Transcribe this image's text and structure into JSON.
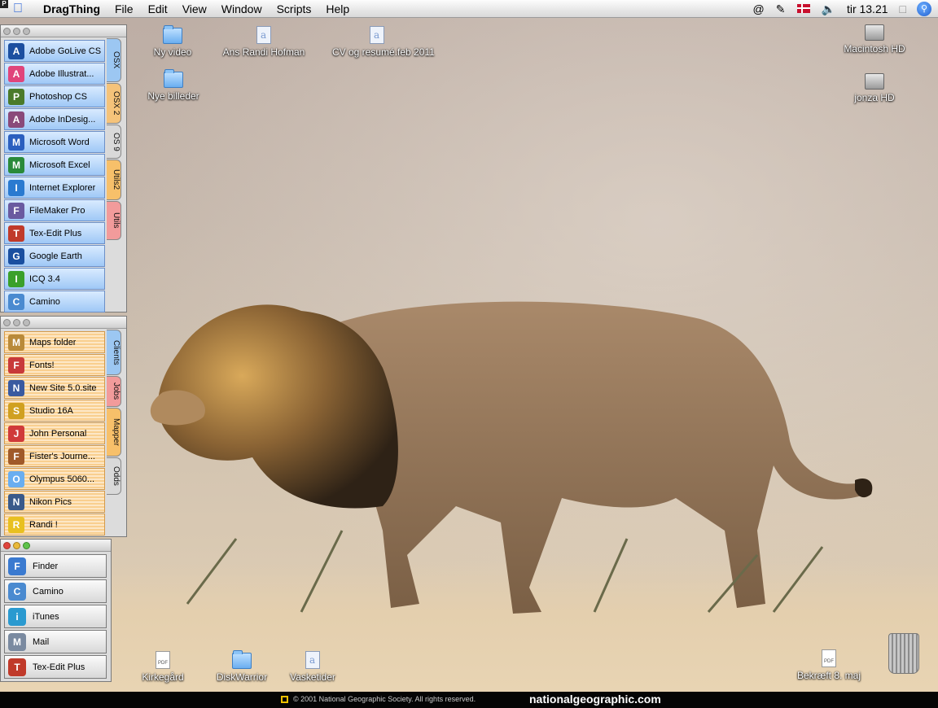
{
  "menubar": {
    "app_name": "DragThing",
    "menus": [
      "File",
      "Edit",
      "View",
      "Window",
      "Scripts",
      "Help"
    ],
    "status": {
      "at_sign": "@",
      "clock": "tir 13.21"
    }
  },
  "desktop": {
    "icons_top": [
      {
        "label": "Ny video",
        "type": "folder"
      },
      {
        "label": "Nye billeder",
        "type": "folder"
      },
      {
        "label": "Ans Randi Hofman",
        "type": "document"
      },
      {
        "label": "CV og resumé.feb 2011",
        "type": "document"
      }
    ],
    "drives": [
      {
        "label": "Macintosh HD"
      },
      {
        "label": "jonza HD"
      }
    ],
    "icons_bottom": [
      {
        "label": "Kirkegård",
        "type": "pdf"
      },
      {
        "label": "DiskWarrior",
        "type": "folder"
      },
      {
        "label": "Vasketider",
        "type": "document"
      },
      {
        "label": "Bekræft 8. maj",
        "type": "pdf"
      }
    ],
    "trash_icon": "trash-icon"
  },
  "dock1": {
    "items": [
      {
        "label": "Adobe GoLive CS",
        "color": "#1c4fa0"
      },
      {
        "label": "Adobe Illustrat...",
        "color": "#e0457b"
      },
      {
        "label": "Photoshop CS",
        "color": "#4a7a2a"
      },
      {
        "label": "Adobe InDesig...",
        "color": "#8a4a7a"
      },
      {
        "label": "Microsoft Word",
        "color": "#2b5fbf"
      },
      {
        "label": "Microsoft Excel",
        "color": "#2a8a3a"
      },
      {
        "label": "Internet Explorer",
        "color": "#2a7ad0"
      },
      {
        "label": "FileMaker Pro",
        "color": "#6a5aa0"
      },
      {
        "label": "Tex-Edit Plus",
        "color": "#c03a2a"
      },
      {
        "label": "Google Earth",
        "color": "#1a4fa0"
      },
      {
        "label": "ICQ 3.4",
        "color": "#3aa02a"
      },
      {
        "label": "Camino",
        "color": "#4a8ad0"
      }
    ],
    "tabs": [
      {
        "label": "OSX",
        "color": "#9cc7f2"
      },
      {
        "label": "OSX 2",
        "color": "#f5c37a"
      },
      {
        "label": "OS 9",
        "color": "#d9d9d9"
      },
      {
        "label": "Utils2",
        "color": "#f7c06a"
      },
      {
        "label": "Utils",
        "color": "#f29b9b"
      }
    ]
  },
  "dock2": {
    "items": [
      {
        "label": "Maps folder",
        "color": "#b98a3a"
      },
      {
        "label": "Fonts!",
        "color": "#c83a3a"
      },
      {
        "label": "New Site 5.0.site",
        "color": "#3a5aa0"
      },
      {
        "label": "Studio 16A",
        "color": "#d0a020"
      },
      {
        "label": "John Personal",
        "color": "#d03a3a"
      },
      {
        "label": "Fister's Journe...",
        "color": "#a05a2a"
      },
      {
        "label": "Olympus 5060...",
        "color": "#6aaef0"
      },
      {
        "label": "Nikon Pics",
        "color": "#3a5a8a"
      },
      {
        "label": "Randi !",
        "color": "#e8c020"
      }
    ],
    "tabs": [
      {
        "label": "Clients",
        "color": "#9cc7f2"
      },
      {
        "label": "Jobs",
        "color": "#f29b9b"
      },
      {
        "label": "Mapper",
        "color": "#f7c06a"
      },
      {
        "label": "Odds",
        "color": "#d9d9d9"
      }
    ]
  },
  "dock3": {
    "items": [
      {
        "label": "Finder",
        "color": "#3a7ad0"
      },
      {
        "label": "Camino",
        "color": "#4a8ad0"
      },
      {
        "label": "iTunes",
        "color": "#2a9ad0"
      },
      {
        "label": "Mail",
        "color": "#7a8aa0"
      },
      {
        "label": "Tex-Edit Plus",
        "color": "#c03a2a"
      }
    ]
  },
  "footer": {
    "copyright": "© 2001 National Geographic Society. All rights reserved.",
    "site": "nationalgeographic.com"
  }
}
